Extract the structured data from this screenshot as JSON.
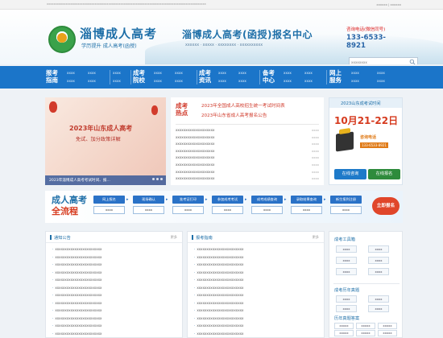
{
  "topbar": {
    "notice": "xxxxxxxxxxxxxxxxxxxxxxxxxxxxxxxxxxxxxxxxxxxxxxxxxxxxxxxxxxxxxxxxxxxxxxxxxxxxxxxxxxxxxxxxxxxxx",
    "links": "xxxxxx | xxxxxx"
  },
  "header": {
    "brand": "淄博成人高考",
    "slogan": "学历提升 成人高考(函授)",
    "center_title": "淄博成人高考(函授)报名中心",
    "center_sub": "xxxxxx · xxxxx · xxxxxxxx · xxxxxxxxxx",
    "hotline_label": "咨询电话(微信同号)",
    "hotline_number": "133-6533-8921",
    "search_placeholder": "xxxxxxxx"
  },
  "nav": [
    {
      "title": "报考\n指南",
      "subs": [
        "xxxx",
        "xxxx",
        "xxxx",
        "xxxx",
        "xxxx",
        "xxxx"
      ]
    },
    {
      "title": "成考\n院校",
      "subs": [
        "xxxx",
        "xxxx",
        "xxxx",
        "xxxx",
        "xxxx",
        "xxxx"
      ]
    },
    {
      "title": "成考\n资讯",
      "subs": [
        "xxxx",
        "xxxx",
        "xxxx",
        "xxxx"
      ]
    },
    {
      "title": "备考\n中心",
      "subs": [
        "xxxx",
        "xxxx",
        "xxxx",
        "xxxx"
      ]
    },
    {
      "title": "网上\n服务",
      "subs": [
        "xxxx",
        "xxxx",
        "xxxx",
        "xxxx"
      ]
    },
    {
      "title": "",
      "subs": [
        "xxxx",
        "xxxx",
        "xxxx",
        "xxxx"
      ]
    }
  ],
  "banner": {
    "title": "2023年山东成人高考",
    "subtitle": "免试、加分政策详解",
    "caption": "2023年淄博成人高考考试时间、报…"
  },
  "news": {
    "tag": "成考\n热点",
    "headline1": "2023年全国成人高校招生统一考试时间表",
    "headline2": "2023年山东省成人高考报名公告",
    "items": [
      {
        "title": "xxxxxxxxxxxxxxxxxxxx",
        "date": "xxxx"
      },
      {
        "title": "xxxxxxxxxxxxxxxxxxxx",
        "date": "xxxx"
      },
      {
        "title": "xxxxxxxxxxxxxxxxxxxx",
        "date": "xxxx"
      },
      {
        "title": "xxxxxxxxxxxxxxxxxxxx",
        "date": "xxxx"
      },
      {
        "title": "xxxxxxxxxxxxxxxxxxxx",
        "date": "xxxx"
      },
      {
        "title": "xxxxxxxxxxxxxxxxxxxx",
        "date": "xxxx"
      },
      {
        "title": "xxxxxxxxxxxxxxxxxxxx",
        "date": "xxxx"
      },
      {
        "title": "xxxxxxxxxxxxxxxxxxxx",
        "date": "xxxx"
      }
    ]
  },
  "info": {
    "header": "2023山东成考试时间",
    "date": "10月21-22日",
    "phone_label": "咨询电话",
    "phone": "133-6533-8921",
    "btn_consult": "在线咨询",
    "btn_apply": "在线报名",
    "colors": {
      "consult": "#1e7ac9",
      "apply": "#2e8b3c"
    }
  },
  "flow": {
    "title_line1": "成人高考",
    "title_line2": "全流程",
    "steps": [
      {
        "name": "网上报名",
        "value": "xxxx"
      },
      {
        "name": "现场确认",
        "value": "xxxx"
      },
      {
        "name": "准考证打印",
        "value": "xxxx"
      },
      {
        "name": "参加成考考试",
        "value": "xxxx"
      },
      {
        "name": "成考成绩查询",
        "value": "xxxx"
      },
      {
        "name": "录取结果查询",
        "value": "xxxx"
      },
      {
        "name": "新生报到注册",
        "value": "xxxx"
      }
    ],
    "cta": "立即报名"
  },
  "panels": {
    "left": {
      "title": "通知公告",
      "more": "更多",
      "items": [
        "xxxxxxxxxxxxxxxxxxxxxxxx",
        "xxxxxxxxxxxxxxxxxxxxxxxx",
        "xxxxxxxxxxxxxxxxxxxxxxxx",
        "xxxxxxxxxxxxxxxxxxxxxxxx",
        "xxxxxxxxxxxxxxxxxxxxxxxx",
        "xxxxxxxxxxxxxxxxxxxxxxxx",
        "xxxxxxxxxxxxxxxxxxxxxxxx",
        "xxxxxxxxxxxxxxxxxxxxxxxx",
        "xxxxxxxxxxxxxxxxxxxxxxxx",
        "xxxxxxxxxxxxxxxxxxxxxxxx",
        "xxxxxxxxxxxxxxxxxxxxxxxx",
        "xxxxxxxxxxxxxxxxxxxxxxxx"
      ]
    },
    "mid": {
      "title": "报考指南",
      "more": "更多",
      "items": [
        "xxxxxxxxxxxxxxxxxxxxxxxx",
        "xxxxxxxxxxxxxxxxxxxxxxxx",
        "xxxxxxxxxxxxxxxxxxxxxxxx",
        "xxxxxxxxxxxxxxxxxxxxxxxx",
        "xxxxxxxxxxxxxxxxxxxxxxxx",
        "xxxxxxxxxxxxxxxxxxxxxxxx",
        "xxxxxxxxxxxxxxxxxxxxxxxx",
        "xxxxxxxxxxxxxxxxxxxxxxxx",
        "xxxxxxxxxxxxxxxxxxxxxxxx",
        "xxxxxxxxxxxxxxxxxxxxxxxx",
        "xxxxxxxxxxxxxxxxxxxxxxxx",
        "xxxxxxxxxxxxxxxxxxxxxxxx"
      ]
    },
    "side": {
      "heading1": "成考工具箱",
      "chips": [
        "xxxx",
        "xxxx",
        "xxxx",
        "xxxx",
        "xxxx",
        "xxxx"
      ],
      "heading2": "成考历年真题",
      "chips2": [
        "xxxx",
        "xxxx",
        "xxxx",
        "xxxx"
      ],
      "heading3": "历年真题答案",
      "years": [
        "xxxxx",
        "xxxxx",
        "xxxxx",
        "xxxxx",
        "xxxxx",
        "xxxxx",
        "xxxxx",
        "xxxxx",
        "xxxxx"
      ]
    }
  },
  "colors": {
    "primary": "#1b75c9",
    "accent": "#d63b1f",
    "brand_green": "#2e8b3c"
  }
}
